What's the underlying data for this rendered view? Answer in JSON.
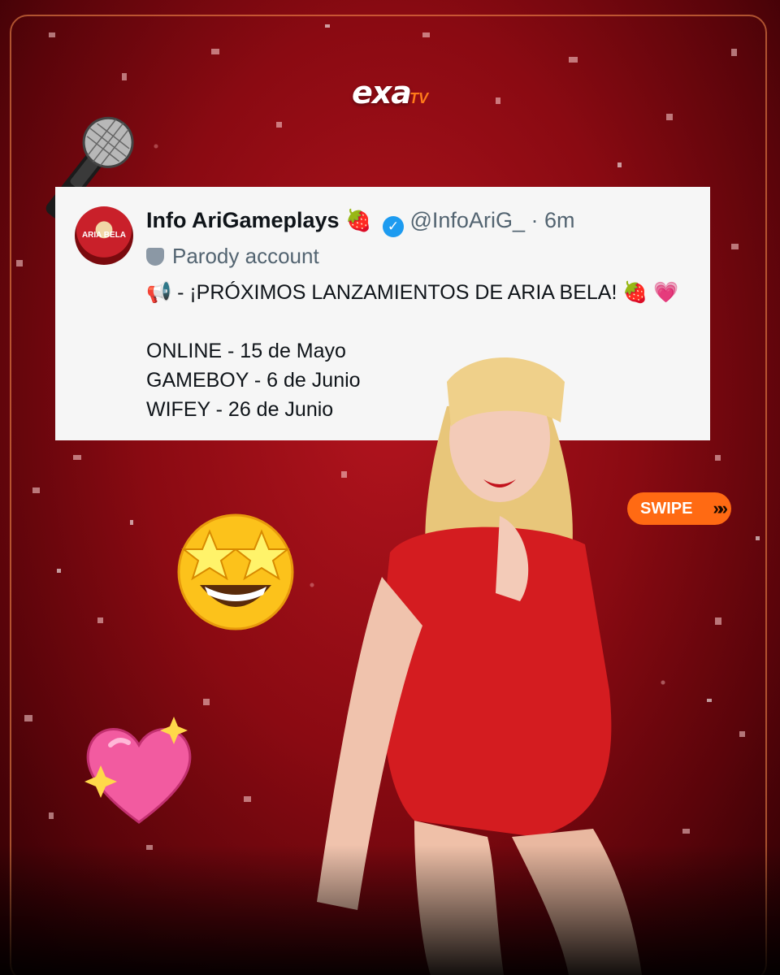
{
  "brand": {
    "logo_main": "exa",
    "logo_sub": "TV"
  },
  "tweet": {
    "avatar_text": "ARIA BELA",
    "name": "Info AriGameplays",
    "name_emoji": "🍓",
    "verified_icon": "✓",
    "handle": "@InfoAriG_",
    "separator": "·",
    "time": "6m",
    "parody_label": "Parody account",
    "headline": "📢 - ¡PRÓXIMOS LANZAMIENTOS DE ARIA BELA! 🍓 💗",
    "releases": [
      "ONLINE - 15 de Mayo",
      "GAMEBOY - 6 de Junio",
      "WIFEY - 26 de Junio"
    ]
  },
  "swipe": {
    "label": "SWIPE",
    "arrows": "»»"
  },
  "decor": {
    "mic": "microphone-icon",
    "star_struck": "star-struck-emoji",
    "sparkling_heart": "sparkling-heart-emoji"
  },
  "colors": {
    "accent": "#ff6a13",
    "verified": "#1d9bf0",
    "background": "#a30f18"
  }
}
